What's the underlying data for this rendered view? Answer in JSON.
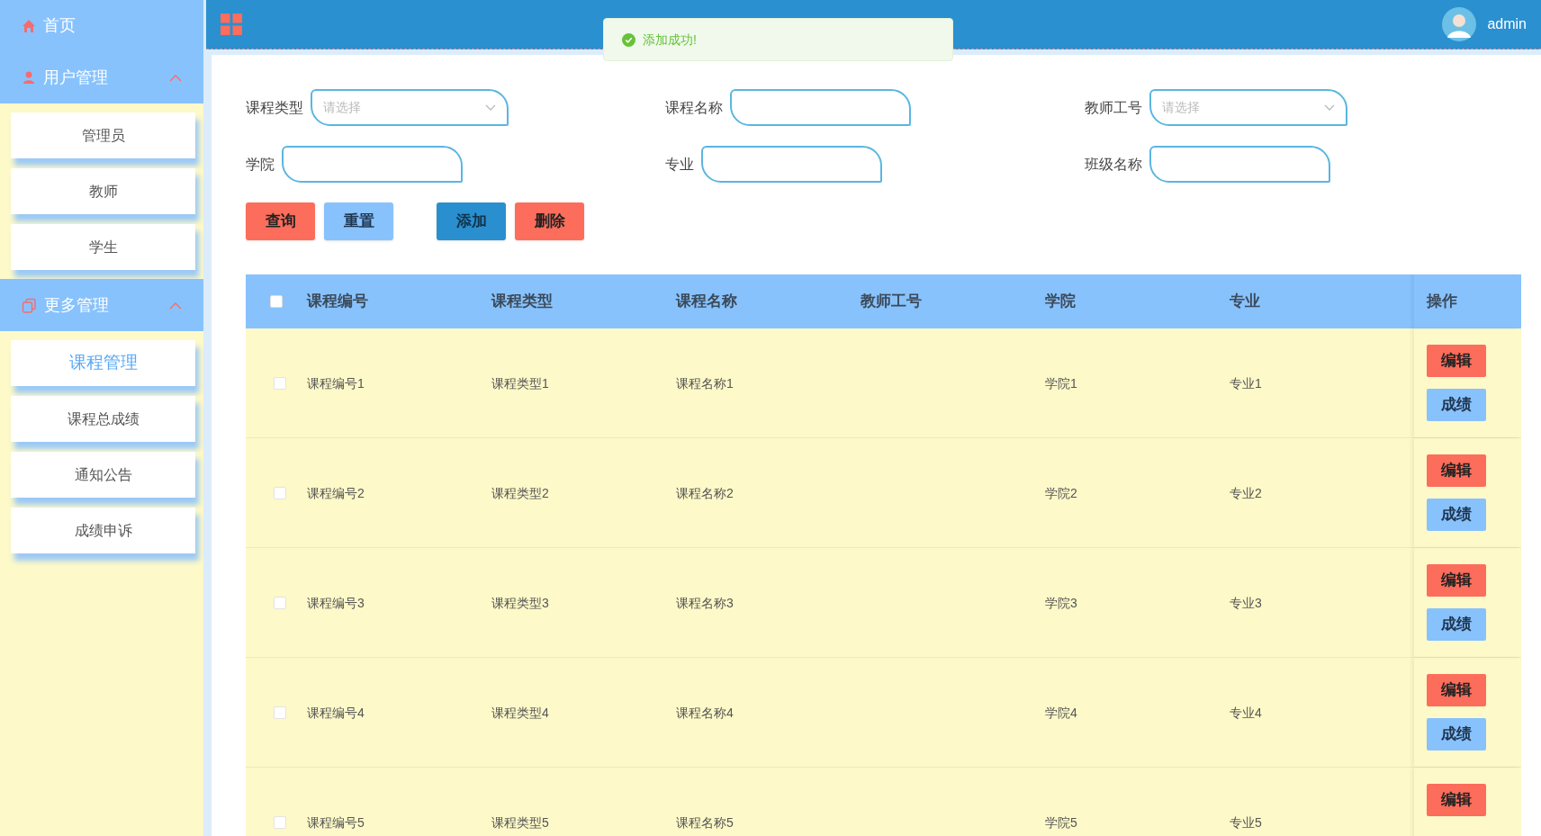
{
  "sidebar": {
    "items": [
      {
        "kind": "link",
        "label": "首页",
        "selected": false
      },
      {
        "kind": "group",
        "label": "用户管理",
        "expanded": true,
        "children": [
          {
            "label": "管理员",
            "selected": false
          },
          {
            "label": "教师",
            "selected": false
          },
          {
            "label": "学生",
            "selected": false
          }
        ]
      },
      {
        "kind": "group",
        "label": "更多管理",
        "expanded": true,
        "children": [
          {
            "label": "课程管理",
            "selected": true
          },
          {
            "label": "课程总成绩",
            "selected": false
          },
          {
            "label": "通知公告",
            "selected": false
          },
          {
            "label": "成绩申诉",
            "selected": false
          }
        ]
      }
    ]
  },
  "topbar": {
    "user": "admin"
  },
  "toast": {
    "message": "添加成功!"
  },
  "filters": [
    {
      "kind": "select",
      "label": "课程类型",
      "placeholder": "请选择"
    },
    {
      "kind": "input",
      "label": "课程名称"
    },
    {
      "kind": "select",
      "label": "教师工号",
      "placeholder": "请选择"
    },
    {
      "kind": "input",
      "label": "学院"
    },
    {
      "kind": "input",
      "label": "专业"
    },
    {
      "kind": "input",
      "label": "班级名称"
    }
  ],
  "buttons": [
    {
      "label": "查询",
      "kind": "danger"
    },
    {
      "label": "重置",
      "kind": "light"
    },
    {
      "label": "添加",
      "kind": "primary"
    },
    {
      "label": "删除",
      "kind": "danger"
    }
  ],
  "table": {
    "all_checked": false,
    "columns": [
      "课程编号",
      "课程类型",
      "课程名称",
      "教师工号",
      "学院",
      "专业"
    ],
    "action_column": "操作",
    "rows": [
      {
        "checked": false,
        "cells": [
          "课程编号1",
          "课程类型1",
          "课程名称1",
          "",
          "学院1",
          "专业1"
        ],
        "actions": [
          {
            "label": "编辑",
            "kind": "danger"
          },
          {
            "label": "成绩",
            "kind": "light"
          }
        ]
      },
      {
        "checked": false,
        "cells": [
          "课程编号2",
          "课程类型2",
          "课程名称2",
          "",
          "学院2",
          "专业2"
        ],
        "actions": [
          {
            "label": "编辑",
            "kind": "danger"
          },
          {
            "label": "成绩",
            "kind": "light"
          }
        ]
      },
      {
        "checked": false,
        "cells": [
          "课程编号3",
          "课程类型3",
          "课程名称3",
          "",
          "学院3",
          "专业3"
        ],
        "actions": [
          {
            "label": "编辑",
            "kind": "danger"
          },
          {
            "label": "成绩",
            "kind": "light"
          }
        ]
      },
      {
        "checked": false,
        "cells": [
          "课程编号4",
          "课程类型4",
          "课程名称4",
          "",
          "学院4",
          "专业4"
        ],
        "actions": [
          {
            "label": "编辑",
            "kind": "danger"
          },
          {
            "label": "成绩",
            "kind": "light"
          }
        ]
      },
      {
        "checked": false,
        "cells": [
          "课程编号5",
          "课程类型5",
          "课程名称5",
          "",
          "学院5",
          "专业5"
        ],
        "actions": [
          {
            "label": "编辑",
            "kind": "danger"
          }
        ]
      }
    ]
  }
}
